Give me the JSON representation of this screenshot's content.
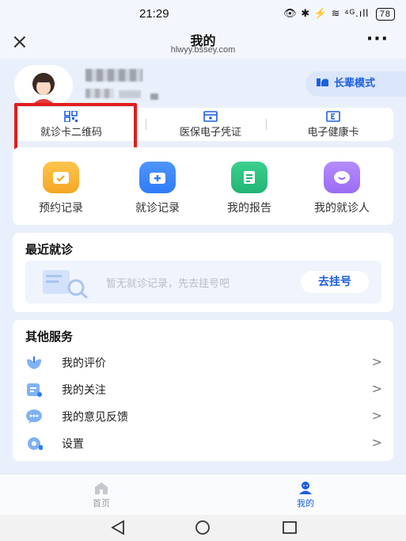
{
  "status_bar": {
    "time": "21:29",
    "icons": "👁 ✱ ⚡ ≋ ⁴ᴳ.ıll",
    "battery": "78"
  },
  "titlebar": {
    "close": "×",
    "title": "我的",
    "subtitle": "hlwyy.bssey.com",
    "more": "···"
  },
  "profile": {
    "elder_mode_label": "长辈模式"
  },
  "quick_actions": [
    {
      "label": "就诊卡二维码"
    },
    {
      "label": "医保电子凭证"
    },
    {
      "label": "电子健康卡"
    }
  ],
  "records": [
    {
      "label": "预约记录",
      "color": "#f5a623"
    },
    {
      "label": "就诊记录",
      "color": "#2f7cf6"
    },
    {
      "label": "我的报告",
      "color": "#22b573"
    },
    {
      "label": "我的就诊人",
      "color": "#9b6cf2"
    }
  ],
  "recent_visits": {
    "title": "最近就诊",
    "empty_text": "暂无就诊记录，先去挂号吧",
    "button_label": "去挂号"
  },
  "other_services": {
    "title": "其他服务",
    "items": [
      {
        "label": "我的评价",
        "arrow": ">"
      },
      {
        "label": "我的关注",
        "arrow": ">"
      },
      {
        "label": "我的意见反馈",
        "arrow": ">"
      },
      {
        "label": "设置",
        "arrow": ">"
      }
    ]
  },
  "bottom_nav": {
    "home": "首页",
    "mine": "我的"
  },
  "colors": {
    "accent": "#1e5fe0",
    "highlight": "#e11d1d"
  }
}
